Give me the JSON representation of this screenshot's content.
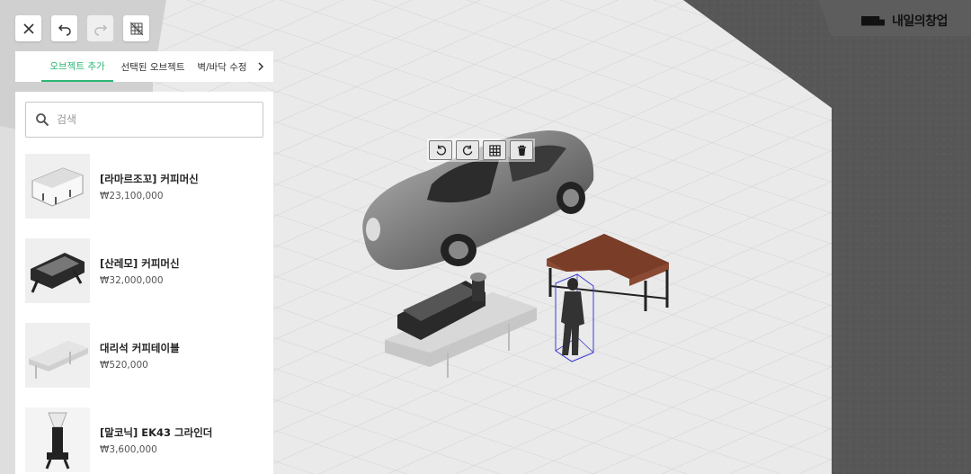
{
  "toolbar": {
    "close_icon": "close-icon",
    "undo_icon": "undo-icon",
    "redo_icon": "redo-icon",
    "grid_off_icon": "grid-off-icon"
  },
  "tabs": [
    {
      "label": "오브젝트 추가",
      "active": true
    },
    {
      "label": "선택된 오브젝트",
      "active": false
    },
    {
      "label": "벽/바닥 수정",
      "active": false
    }
  ],
  "search": {
    "placeholder": "검색",
    "value": ""
  },
  "items": [
    {
      "name": "[라마르조꼬] 커피머신",
      "price": "₩23,100,000",
      "icon": "espresso-machine-white"
    },
    {
      "name": "[산레모] 커피머신",
      "price": "₩32,000,000",
      "icon": "espresso-machine-black"
    },
    {
      "name": "대리석 커피테이블",
      "price": "₩520,000",
      "icon": "marble-table"
    },
    {
      "name": "[말코닉] EK43 그라인더",
      "price": "₩3,600,000",
      "icon": "coffee-grinder"
    }
  ],
  "logo": {
    "text": "내일의창업"
  },
  "object_toolbar": [
    "rotate-left-icon",
    "rotate-right-icon",
    "grid-icon",
    "trash-icon"
  ],
  "colors": {
    "accent": "#2bb673",
    "floor": "#e6e6e6",
    "wall": "#595959"
  }
}
